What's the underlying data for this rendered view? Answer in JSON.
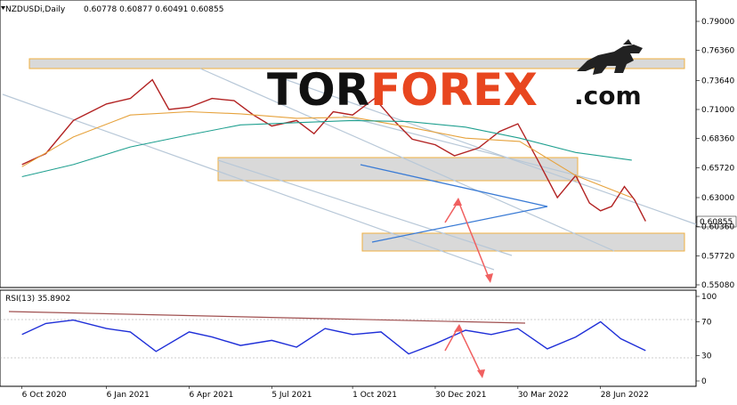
{
  "header": {
    "symbol": "NZDUSDi,Daily",
    "ohlc": "0.60778 0.60877 0.60491 0.60855"
  },
  "logo": {
    "part1": "TOR",
    "part2": "FOREX",
    "part3": ".com"
  },
  "rsi_label": "RSI(13) 35.8902",
  "current_price": "0.60855",
  "colors": {
    "price_line": "#b22222",
    "ma_fast": "#e6a23c",
    "ma_slow": "#20a090",
    "rsi": "#1f2fd8",
    "zone_fill": "#d9d9d9",
    "zone_border": "#f0b040",
    "channel": "#b8c8d8",
    "triangle": "#3a7bd5",
    "forecast": "#f06060",
    "rsi_trend": "#a05050",
    "logo_accent": "#e8461f"
  },
  "chart_data": [
    {
      "type": "line",
      "title": "NZDUSDi,Daily",
      "x_tick_labels": [
        "6 Oct 2020",
        "6 Jan 2021",
        "6 Apr 2021",
        "5 Jul 2021",
        "1 Oct 2021",
        "30 Dec 2021",
        "30 Mar 2022",
        "28 Jun 2022"
      ],
      "y_tick_labels": [
        "0.79000",
        "0.76360",
        "0.73640",
        "0.71000",
        "0.68360",
        "0.65720",
        "0.63000",
        "0.60360",
        "0.57720",
        "0.55080"
      ],
      "ylim": [
        0.545,
        0.8
      ],
      "series": [
        {
          "name": "",
          "x": [
            "2020-10-06",
            "2020-11-01",
            "2020-12-01",
            "2021-01-06",
            "2021-02-01",
            "2021-02-25",
            "2021-03-15",
            "2021-04-06",
            "2021-05-01",
            "2021-05-25",
            "2021-06-15",
            "2021-07-05",
            "2021-08-01",
            "2021-08-20",
            "2021-09-10",
            "2021-10-01",
            "2021-10-25",
            "2021-11-15",
            "2021-12-05",
            "2021-12-30",
            "2022-01-20",
            "2022-02-15",
            "2022-03-10",
            "2022-03-30",
            "2022-04-20",
            "2022-05-12",
            "2022-06-01",
            "2022-06-16",
            "2022-06-28",
            "2022-07-10",
            "2022-07-24",
            "2022-08-04",
            "2022-08-16"
          ],
          "y": [
            0.66,
            0.67,
            0.7,
            0.715,
            0.72,
            0.737,
            0.71,
            0.712,
            0.72,
            0.718,
            0.705,
            0.695,
            0.7,
            0.688,
            0.708,
            0.705,
            0.72,
            0.7,
            0.683,
            0.678,
            0.668,
            0.675,
            0.69,
            0.697,
            0.665,
            0.63,
            0.65,
            0.625,
            0.618,
            0.622,
            0.64,
            0.628,
            0.6085
          ]
        },
        {
          "name": "",
          "x": [
            "2020-10-06",
            "2020-12-01",
            "2021-02-01",
            "2021-04-06",
            "2021-06-01",
            "2021-08-01",
            "2021-10-01",
            "2021-12-01",
            "2022-02-01",
            "2022-04-01",
            "2022-06-01",
            "2022-08-01"
          ],
          "y": [
            0.658,
            0.685,
            0.705,
            0.708,
            0.706,
            0.702,
            0.703,
            0.694,
            0.684,
            0.681,
            0.65,
            0.63
          ]
        },
        {
          "name": "",
          "x": [
            "2020-10-06",
            "2020-12-01",
            "2021-02-01",
            "2021-04-06",
            "2021-06-01",
            "2021-08-01",
            "2021-10-01",
            "2021-12-01",
            "2022-02-01",
            "2022-04-01",
            "2022-06-01",
            "2022-08-01"
          ],
          "y": [
            0.649,
            0.66,
            0.676,
            0.687,
            0.696,
            0.698,
            0.7,
            0.699,
            0.694,
            0.684,
            0.671,
            0.664
          ]
        }
      ],
      "zones": [
        {
          "from": 0.753,
          "to": 0.76
        },
        {
          "from": 0.65,
          "to": 0.665
        },
        {
          "from": 0.588,
          "to": 0.598
        }
      ],
      "current_price": 0.60855
    },
    {
      "type": "line",
      "title": "RSI(13) 35.8902",
      "y_tick_labels": [
        "100",
        "70",
        "30",
        "0"
      ],
      "ylim": [
        0,
        100
      ],
      "series": [
        {
          "name": "",
          "x": [
            "2020-10-06",
            "2020-11-01",
            "2020-12-01",
            "2021-01-06",
            "2021-02-01",
            "2021-03-01",
            "2021-04-06",
            "2021-05-01",
            "2021-06-01",
            "2021-07-05",
            "2021-08-01",
            "2021-09-01",
            "2021-10-01",
            "2021-11-01",
            "2021-12-01",
            "2021-12-30",
            "2022-02-01",
            "2022-03-01",
            "2022-03-30",
            "2022-05-01",
            "2022-06-01",
            "2022-06-28",
            "2022-07-20",
            "2022-08-16"
          ],
          "y": [
            55,
            68,
            72,
            62,
            58,
            35,
            58,
            52,
            42,
            48,
            40,
            62,
            55,
            58,
            32,
            44,
            60,
            55,
            62,
            38,
            52,
            70,
            50,
            35.89
          ]
        }
      ]
    }
  ]
}
